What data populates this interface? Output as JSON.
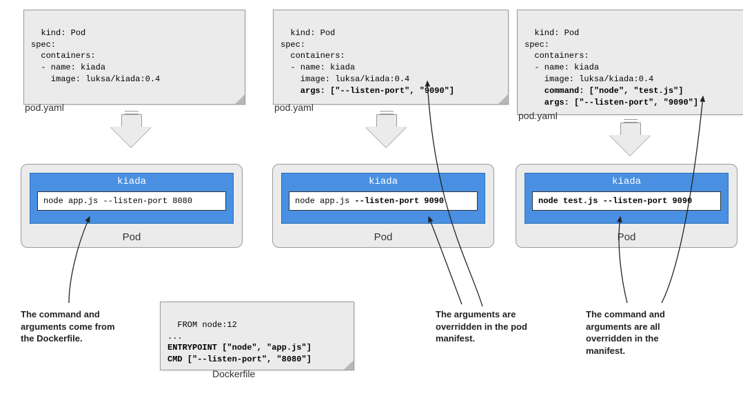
{
  "col1": {
    "yaml": "kind: Pod\nspec:\n  containers:\n  - name: kiada\n    image: luksa/kiada:0.4",
    "file_label": "pod.yaml",
    "container_name": "kiada",
    "cmd": "node app.js --listen-port 8080",
    "pod_label": "Pod"
  },
  "col2": {
    "yaml_plain": "kind: Pod\nspec:\n  containers:\n  - name: kiada\n    image: luksa/kiada:0.4",
    "yaml_bold": "    args: [\"--listen-port\", \"9090\"]",
    "file_label": "pod.yaml",
    "container_name": "kiada",
    "cmd_plain": "node app.js ",
    "cmd_bold": "--listen-port 9090",
    "pod_label": "Pod"
  },
  "col3": {
    "yaml_plain": "kind: Pod\nspec:\n  containers:\n  - name: kiada\n    image: luksa/kiada:0.4",
    "yaml_bold": "    command: [\"node\", \"test.js\"]\n    args: [\"--listen-port\", \"9090\"]",
    "file_label": "pod.yaml",
    "container_name": "kiada",
    "cmd": "node test.js --listen-port 9090",
    "pod_label": "Pod"
  },
  "dockerfile": {
    "text": "FROM node:12\n...\nENTRYPOINT [\"node\", \"app.js\"]\nCMD [\"--listen-port\", \"8080\"]",
    "label": "Dockerfile"
  },
  "captions": {
    "c1": "The command and\narguments come from\nthe Dockerfile.",
    "c2": "The arguments are\noverridden in the pod\nmanifest.",
    "c3": "The command and\narguments are all\noverridden in the\nmanifest."
  }
}
